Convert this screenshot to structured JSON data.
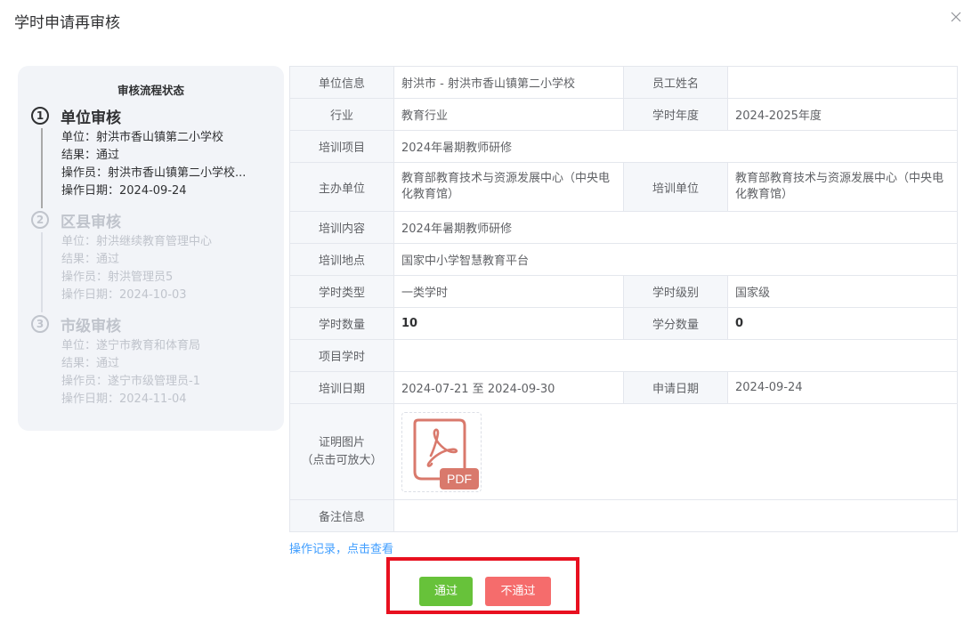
{
  "dialog": {
    "title": "学时申请再审核"
  },
  "steps_panel": {
    "title": "审核流程状态",
    "steps": [
      {
        "num": "1",
        "name": "单位审核",
        "unit": "单位：射洪市香山镇第二小学校",
        "result": "结果：通过",
        "operator": "操作员：射洪市香山镇第二小学校...",
        "date": "操作日期：2024-09-24"
      },
      {
        "num": "2",
        "name": "区县审核",
        "unit": "单位：射洪继续教育管理中心",
        "result": "结果：通过",
        "operator": "操作员：射洪管理员5",
        "date": "操作日期：2024-10-03"
      },
      {
        "num": "3",
        "name": "市级审核",
        "unit": "单位：遂宁市教育和体育局",
        "result": "结果：通过",
        "operator": "操作员：遂宁市级管理员-1",
        "date": "操作日期：2024-11-04"
      }
    ]
  },
  "detail": {
    "unit_label": "单位信息",
    "unit_value": "射洪市 - 射洪市香山镇第二小学校",
    "employee_label": "员工姓名",
    "employee_value": "",
    "industry_label": "行业",
    "industry_value": "教育行业",
    "year_label": "学时年度",
    "year_value": "2024-2025年度",
    "project_label": "培训项目",
    "project_value": "2024年暑期教师研修",
    "host_label": "主办单位",
    "host_value": "教育部教育技术与资源发展中心（中央电化教育馆）",
    "trainer_label": "培训单位",
    "trainer_value": "教育部教育技术与资源发展中心（中央电化教育馆）",
    "content_label": "培训内容",
    "content_value": "2024年暑期教师研修",
    "location_label": "培训地点",
    "location_value": "国家中小学智慧教育平台",
    "hour_type_label": "学时类型",
    "hour_type_value": "一类学时",
    "hour_level_label": "学时级别",
    "hour_level_value": "国家级",
    "hours_label": "学时数量",
    "hours_value": "10",
    "credits_label": "学分数量",
    "credits_value": "0",
    "project_hours_label": "项目学时",
    "project_hours_value": "",
    "train_date_label": "培训日期",
    "train_date_value": "2024-07-21 至 2024-09-30",
    "apply_date_label": "申请日期",
    "apply_date_value": "2024-09-24",
    "proof_label_1": "证明图片",
    "proof_label_2": "（点击可放大）",
    "proof_badge": "PDF",
    "remark_label": "备注信息",
    "remark_value": ""
  },
  "oplog_link": "操作记录，点击查看",
  "actions": {
    "pass_label": "通过",
    "reject_label": "不通过"
  },
  "colors": {
    "pass": "#67c23a",
    "reject": "#f56c6c",
    "link": "#409eff",
    "highlight": "#e8101f",
    "pdf_icon": "#d9796c",
    "panel_bg": "#f2f4f8"
  },
  "icons": {
    "close": "close-icon",
    "pdf": "pdf-file-icon"
  }
}
